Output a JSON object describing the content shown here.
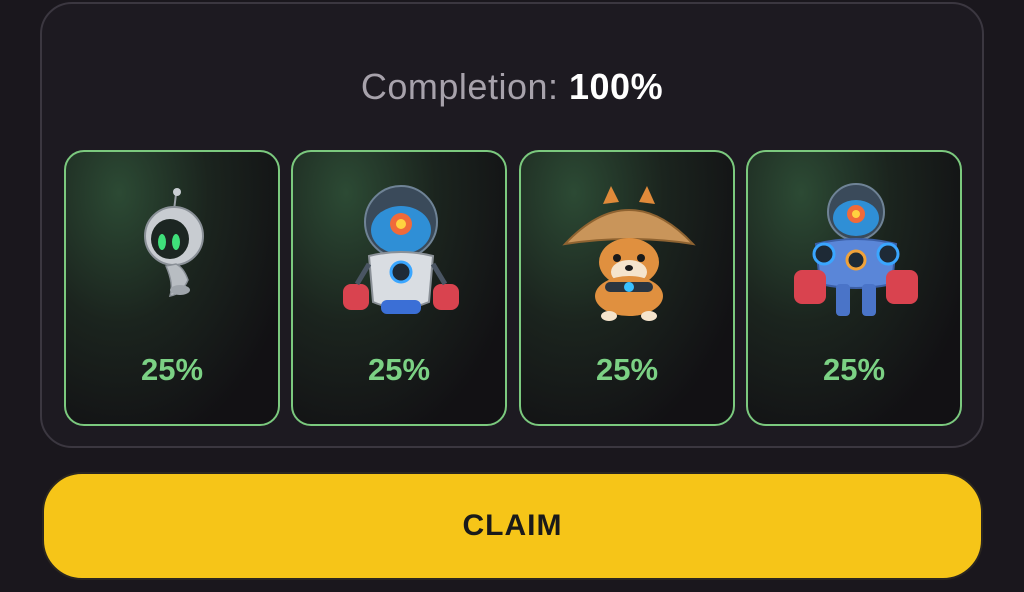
{
  "completion": {
    "label": "Completion:",
    "value": "100%"
  },
  "cards": [
    {
      "name": "mini robot",
      "icon": "astronaut-robot-icon",
      "percent": "25%"
    },
    {
      "name": "boxer robot",
      "icon": "boxing-robot-icon",
      "percent": "25%"
    },
    {
      "name": "shiba dog",
      "icon": "shiba-dog-icon",
      "percent": "25%"
    },
    {
      "name": "mech robot",
      "icon": "mech-robot-icon",
      "percent": "25%"
    }
  ],
  "claim": {
    "label": "CLAIM"
  },
  "colors": {
    "accent": "#f6c518",
    "card_border": "#7bc97e",
    "percent": "#7bd184",
    "background": "#1a171d"
  }
}
